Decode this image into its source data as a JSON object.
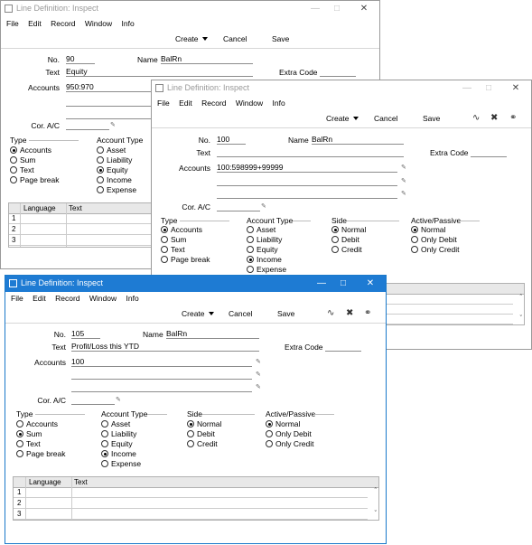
{
  "menu": [
    "File",
    "Edit",
    "Record",
    "Window",
    "Info"
  ],
  "toolbar": {
    "create": "Create",
    "cancel": "Cancel",
    "save": "Save"
  },
  "labels": {
    "no": "No.",
    "name": "Name",
    "text": "Text",
    "accounts": "Accounts",
    "extra_code": "Extra Code",
    "cor_ac": "Cor. A/C",
    "type": "Type",
    "account_type": "Account Type",
    "side": "Side",
    "active_passive": "Active/Passive",
    "language": "Language",
    "text_col": "Text"
  },
  "type_options": [
    "Accounts",
    "Sum",
    "Text",
    "Page break"
  ],
  "account_type_options": [
    "Asset",
    "Liability",
    "Equity",
    "Income",
    "Expense"
  ],
  "side_options": [
    "Normal",
    "Debit",
    "Credit"
  ],
  "active_passive_options": [
    "Normal",
    "Only Debit",
    "Only Credit"
  ],
  "row_numbers": [
    "1",
    "2",
    "3"
  ],
  "windows": {
    "w1": {
      "title": "Line Definition: Inspect",
      "no": "90",
      "name": "BalRn",
      "text": "Equity",
      "accounts": "950:970",
      "type": "Accounts",
      "account_type": "Equity"
    },
    "w2": {
      "title": "Line Definition: Inspect",
      "no": "100",
      "name": "BalRn",
      "text": "",
      "accounts": "100:598999+99999",
      "type": "Accounts",
      "account_type": "Income",
      "side": "Normal",
      "active_passive": "Normal"
    },
    "w3": {
      "title": "Line Definition: Inspect",
      "no": "105",
      "name": "BalRn",
      "text": "Profit/Loss this YTD",
      "accounts": "100",
      "type": "Sum",
      "account_type": "Income",
      "side": "Normal",
      "active_passive": "Normal"
    }
  },
  "icons": {
    "minimize": "minimize-icon",
    "maximize": "maximize-icon",
    "close": "close-icon",
    "window": "window-icon",
    "sort": "sort-icon",
    "expand": "expand-icon",
    "attach": "paperclip-icon",
    "pin": "paste-special-icon"
  },
  "colors": {
    "active_titlebar": "#1e7bd3"
  }
}
